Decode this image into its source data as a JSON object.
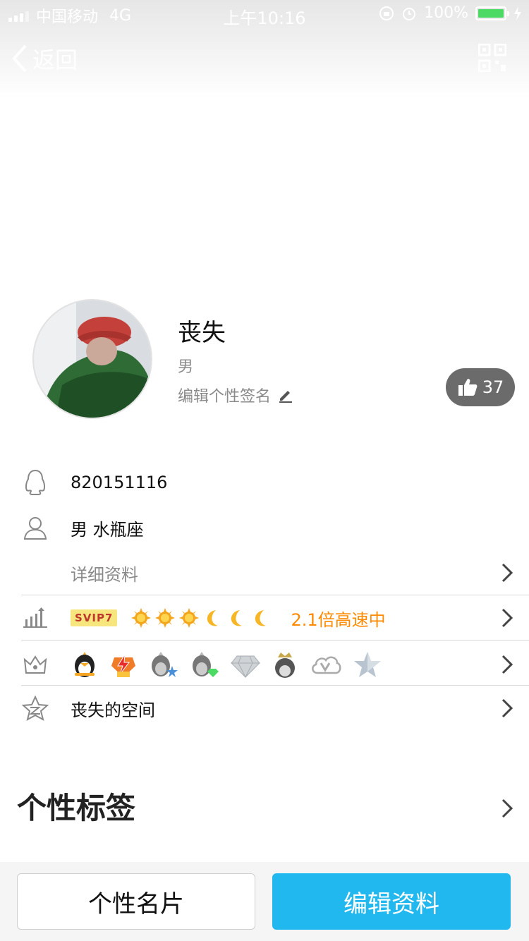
{
  "status_bar": {
    "carrier": "中国移动",
    "network": "4G",
    "time": "上午10:16",
    "battery": "100%"
  },
  "nav": {
    "back_label": "返回"
  },
  "profile": {
    "nickname": "丧失",
    "gender": "男",
    "signature": "编辑个性签名",
    "likes": "37"
  },
  "info": {
    "qq_number": "820151116",
    "gender_sign": "男 水瓶座",
    "details_label": "详细资料",
    "svip_badge": "SVIP7",
    "speed_text": "2.1倍高速中",
    "space_label": "丧失的空间"
  },
  "tags": {
    "title": "个性标签"
  },
  "buttons": {
    "card": "个性名片",
    "edit": "编辑资料"
  },
  "colors": {
    "accent": "#20b8ef",
    "speed": "#ff8a00",
    "like_pill": "#6b6b6b"
  }
}
